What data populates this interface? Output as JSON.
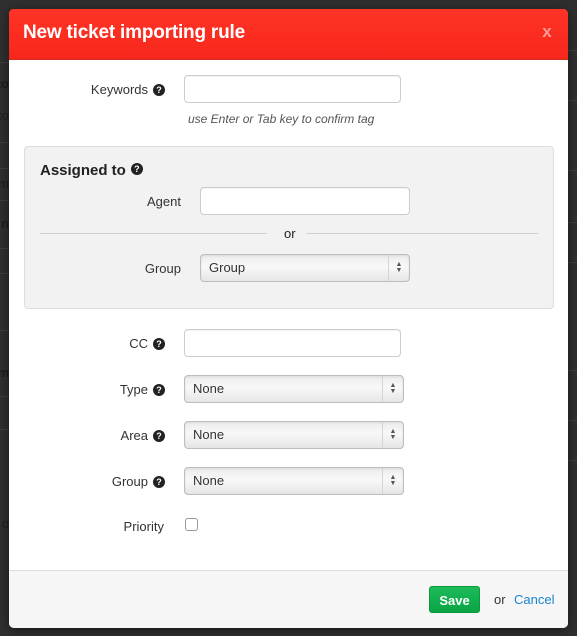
{
  "modal": {
    "title": "New ticket importing rule",
    "close_label": "x"
  },
  "form": {
    "keywords": {
      "label": "Keywords",
      "value": "",
      "placeholder": "",
      "hint": "use Enter or Tab key to confirm tag"
    },
    "assigned_to": {
      "title": "Assigned to",
      "agent": {
        "label": "Agent",
        "value": ""
      },
      "separator": "or",
      "group": {
        "label": "Group",
        "selected": "Group"
      }
    },
    "cc": {
      "label": "CC",
      "value": ""
    },
    "type": {
      "label": "Type",
      "selected": "None"
    },
    "area": {
      "label": "Area",
      "selected": "None"
    },
    "group": {
      "label": "Group",
      "selected": "None"
    },
    "priority": {
      "label": "Priority",
      "checked": false
    }
  },
  "footer": {
    "save_label": "Save",
    "or_text": "or",
    "cancel_label": "Cancel"
  },
  "colors": {
    "header": "#ff2a1f",
    "save": "#12b04f",
    "link": "#1a85d0"
  },
  "icons": {
    "help": "?",
    "select_up": "▲",
    "select_down": "▼"
  },
  "background": {
    "left_fragments": [
      "to",
      "to",
      "m",
      "n",
      "m",
      "o"
    ]
  }
}
